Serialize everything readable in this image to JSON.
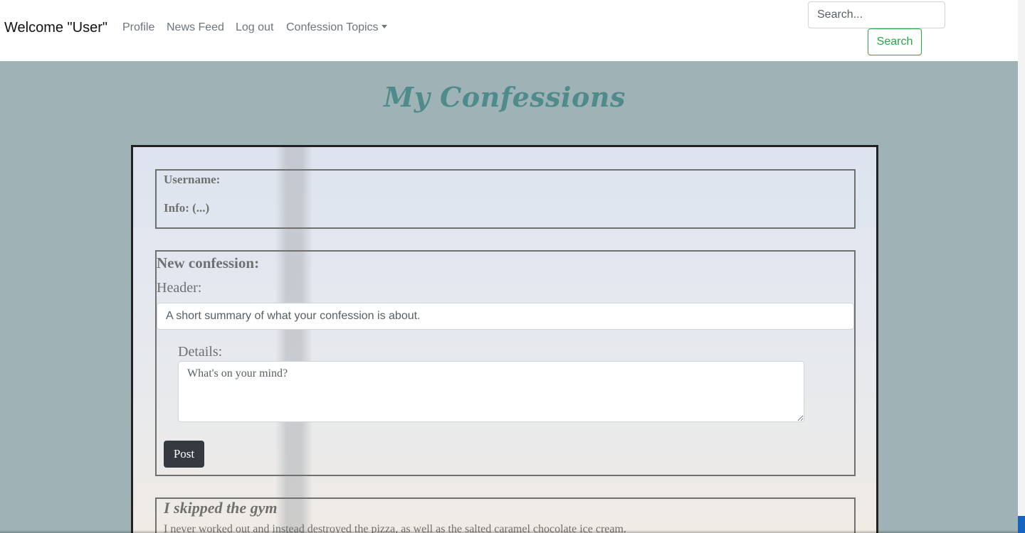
{
  "navbar": {
    "brand": "Welcome \"User\"",
    "links": [
      "Profile",
      "News Feed",
      "Log out",
      "Confession Topics"
    ],
    "search_placeholder": "Search...",
    "search_button": "Search"
  },
  "page_title": "My Confessions",
  "user_info": {
    "username_label": "Username:",
    "info_label": "Info: (...)"
  },
  "new_confession": {
    "heading": "New confession:",
    "header_label": "Header:",
    "header_placeholder": "A short summary of what your confession is about.",
    "details_label": "Details:",
    "details_placeholder": "What's on your mind?",
    "post_button": "Post"
  },
  "confessions": [
    {
      "title": "I skipped the gym",
      "body": "I never worked out and instead destroyed the pizza, as well as the salted caramel chocolate ice cream."
    }
  ]
}
